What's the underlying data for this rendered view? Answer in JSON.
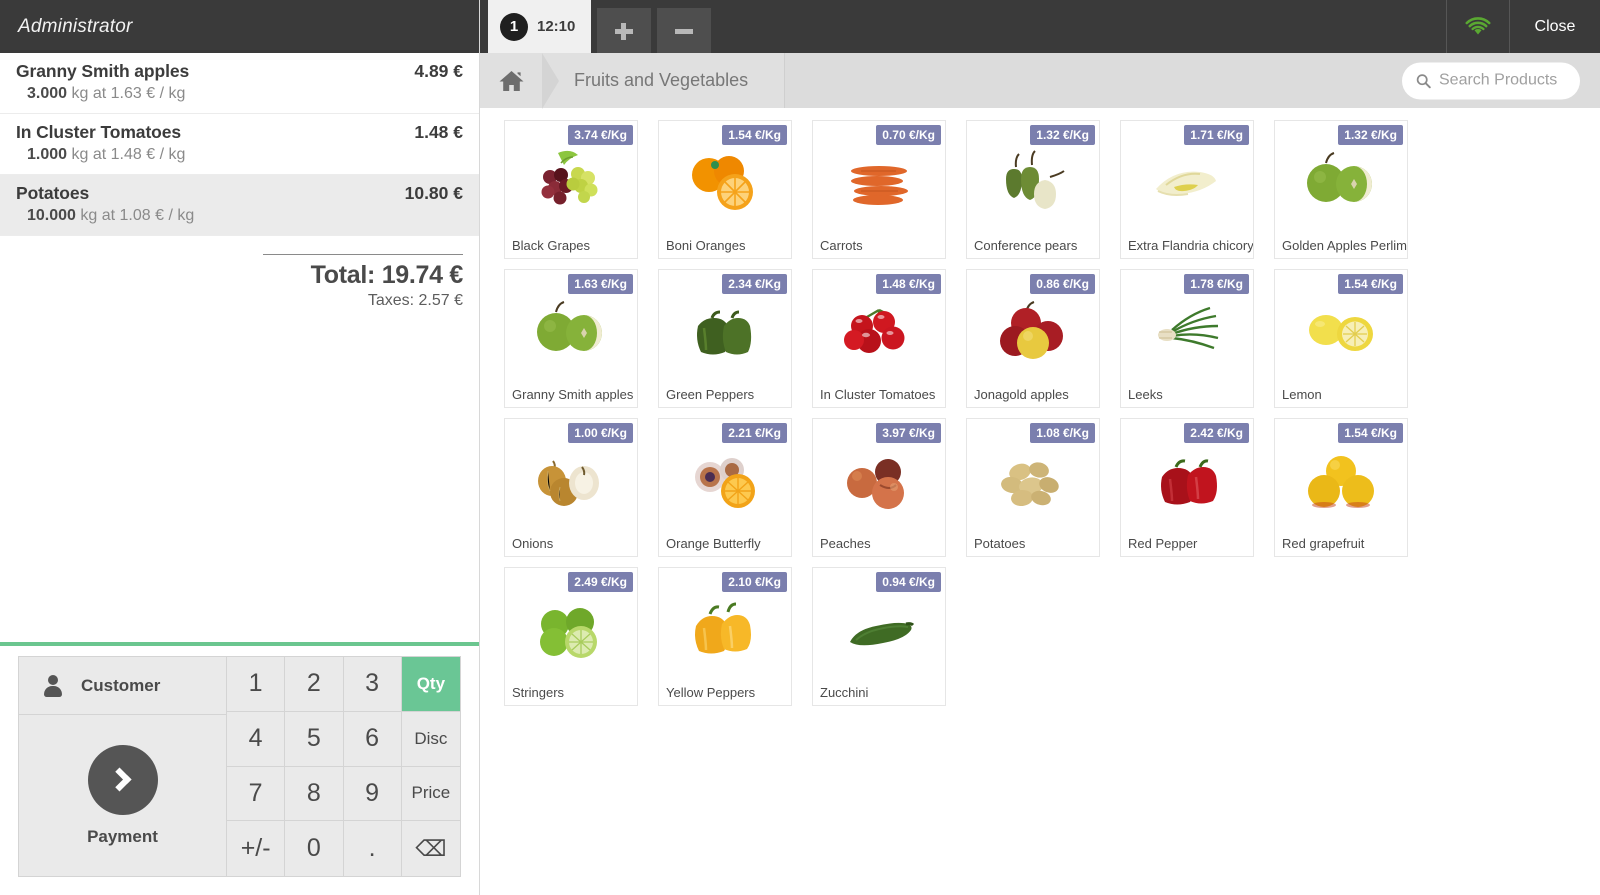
{
  "cashier": {
    "name": "Administrator"
  },
  "order": {
    "lines": [
      {
        "name": "Granny Smith apples",
        "price": "4.89 €",
        "qty": "3.000",
        "detail": "kg at 1.63 € / kg",
        "selected": false
      },
      {
        "name": "In Cluster Tomatoes",
        "price": "1.48 €",
        "qty": "1.000",
        "detail": "kg at 1.48 € / kg",
        "selected": false
      },
      {
        "name": "Potatoes",
        "price": "10.80 €",
        "qty": "10.000",
        "detail": "kg at 1.08 € / kg",
        "selected": true
      }
    ],
    "total_label": "Total: 19.74 €",
    "taxes_label": "Taxes: 2.57 €"
  },
  "keypad": {
    "customer_label": "Customer",
    "payment_label": "Payment",
    "keys": [
      {
        "label": "1",
        "type": "digit"
      },
      {
        "label": "2",
        "type": "digit"
      },
      {
        "label": "3",
        "type": "digit"
      },
      {
        "label": "Qty",
        "type": "fn",
        "active": true
      },
      {
        "label": "4",
        "type": "digit"
      },
      {
        "label": "5",
        "type": "digit"
      },
      {
        "label": "6",
        "type": "digit"
      },
      {
        "label": "Disc",
        "type": "fn"
      },
      {
        "label": "7",
        "type": "digit"
      },
      {
        "label": "8",
        "type": "digit"
      },
      {
        "label": "9",
        "type": "digit"
      },
      {
        "label": "Price",
        "type": "fn"
      },
      {
        "label": "+/-",
        "type": "digit"
      },
      {
        "label": "0",
        "type": "digit"
      },
      {
        "label": ".",
        "type": "digit"
      },
      {
        "label": "⌫",
        "type": "back"
      }
    ]
  },
  "topbar": {
    "tab": {
      "number": "1",
      "time": "12:10"
    },
    "add_label": "+",
    "remove_label": "−",
    "wifi_icon": "wifi-icon",
    "wifi_color": "#5aa832",
    "close_label": "Close"
  },
  "breadcrumb": {
    "home_icon": "home-icon",
    "category": "Fruits and Vegetables"
  },
  "search": {
    "icon": "search-icon",
    "placeholder": "Search Products",
    "value": ""
  },
  "products": [
    {
      "name": "Black Grapes",
      "price": "3.74 €/Kg",
      "icon": "grapes"
    },
    {
      "name": "Boni Oranges",
      "price": "1.54 €/Kg",
      "icon": "oranges"
    },
    {
      "name": "Carrots",
      "price": "0.70 €/Kg",
      "icon": "carrots"
    },
    {
      "name": "Conference pears",
      "price": "1.32 €/Kg",
      "icon": "pears"
    },
    {
      "name": "Extra Flandria chicory",
      "price": "1.71 €/Kg",
      "icon": "chicory"
    },
    {
      "name": "Golden Apples Perlim",
      "price": "1.32 €/Kg",
      "icon": "green-apples"
    },
    {
      "name": "Granny Smith apples",
      "price": "1.63 €/Kg",
      "icon": "green-apples"
    },
    {
      "name": "Green Peppers",
      "price": "2.34 €/Kg",
      "icon": "green-peppers"
    },
    {
      "name": "In Cluster Tomatoes",
      "price": "1.48 €/Kg",
      "icon": "tomatoes"
    },
    {
      "name": "Jonagold apples",
      "price": "0.86 €/Kg",
      "icon": "red-apples"
    },
    {
      "name": "Leeks",
      "price": "1.78 €/Kg",
      "icon": "leeks"
    },
    {
      "name": "Lemon",
      "price": "1.54 €/Kg",
      "icon": "lemons"
    },
    {
      "name": "Onions",
      "price": "1.00 €/Kg",
      "icon": "onions"
    },
    {
      "name": "Orange Butterfly",
      "price": "2.21 €/Kg",
      "icon": "orange-butterfly"
    },
    {
      "name": "Peaches",
      "price": "3.97 €/Kg",
      "icon": "peaches"
    },
    {
      "name": "Potatoes",
      "price": "1.08 €/Kg",
      "icon": "potatoes"
    },
    {
      "name": "Red Pepper",
      "price": "2.42 €/Kg",
      "icon": "red-peppers"
    },
    {
      "name": "Red grapefruit",
      "price": "1.54 €/Kg",
      "icon": "grapefruit"
    },
    {
      "name": "Stringers",
      "price": "2.49 €/Kg",
      "icon": "limes"
    },
    {
      "name": "Yellow Peppers",
      "price": "2.10 €/Kg",
      "icon": "yellow-peppers"
    },
    {
      "name": "Zucchini",
      "price": "0.94 €/Kg",
      "icon": "zucchini"
    }
  ]
}
